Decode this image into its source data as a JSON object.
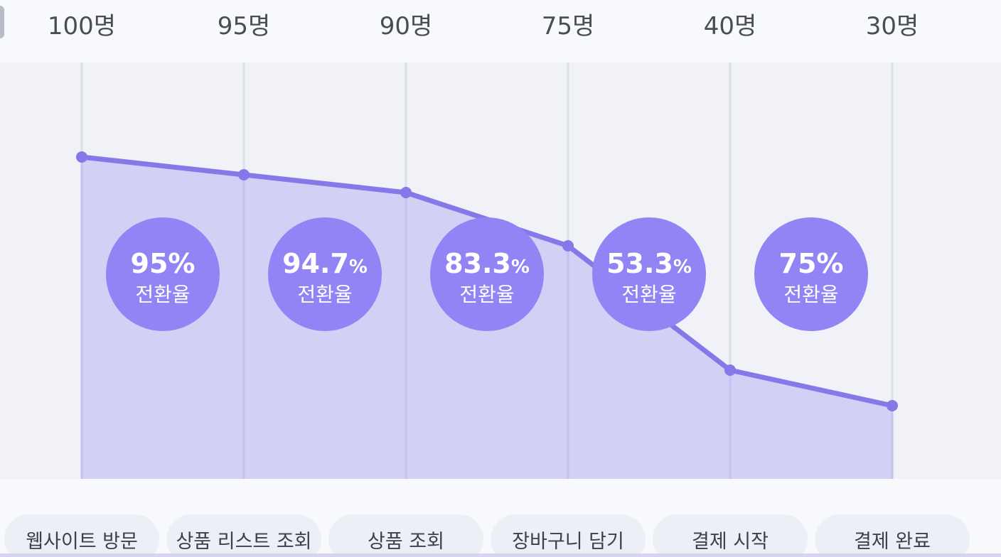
{
  "colors": {
    "line": "#8678e8",
    "area": "#d1cdf6",
    "bubble": "#9284f4",
    "gridline": "#dcdfe8"
  },
  "chart_data": {
    "type": "area",
    "categories": [
      "웹사이트 방문",
      "상품 리스트 조회",
      "상품 조회",
      "장바구니 담기",
      "결제 시작",
      "결제 완료"
    ],
    "count_labels": [
      "100명",
      "95명",
      "90명",
      "75명",
      "40명",
      "30명"
    ],
    "values": [
      100,
      95,
      90,
      75,
      40,
      30
    ],
    "ylim": [
      0,
      135
    ],
    "grid": "vertical",
    "conversion_rates": [
      {
        "value": "95",
        "unit": "%",
        "label": "전환율",
        "rate": 95
      },
      {
        "value": "94.7",
        "unit": "%",
        "label": "전환율",
        "rate": 94.7
      },
      {
        "value": "83.3",
        "unit": "%",
        "label": "전환율",
        "rate": 83.3
      },
      {
        "value": "53.3",
        "unit": "%",
        "label": "전환율",
        "rate": 53.3
      },
      {
        "value": "75",
        "unit": "%",
        "label": "전환율",
        "rate": 75
      }
    ]
  }
}
